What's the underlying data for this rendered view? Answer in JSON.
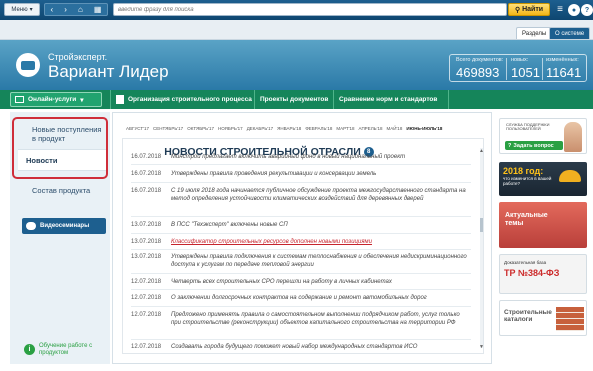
{
  "topbar": {
    "menu_label": "Меню",
    "search_placeholder": "введите фразу для поиска",
    "find_label": "Найти"
  },
  "tabs": {
    "sections": "Разделы",
    "about": "О системе"
  },
  "header": {
    "brand_line1": "Стройэксперт.",
    "brand_line2": "Вариант Лидер",
    "stats": [
      {
        "label": "Всего документов:",
        "value": "469893"
      },
      {
        "label": "новых:",
        "value": "1051"
      },
      {
        "label": "изменённых:",
        "value": "11641"
      }
    ]
  },
  "nav": {
    "online": "Онлайн-услуги",
    "items": [
      "Организация строительного процесса",
      "Проекты документов",
      "Сравнение норм и стандартов"
    ]
  },
  "sidebar": {
    "new_arrivals": "Новые поступления в продукт",
    "news": "Новости",
    "composition": "Состав продукта",
    "webinars": "Видеосеминары",
    "learn": "Обучение работе с продуктом"
  },
  "months": [
    "АВГУСТ'17",
    "СЕНТЯБРЬ'17",
    "ОКТЯБРЬ'17",
    "НОЯБРЬ'17",
    "ДЕКАБРЬ'17",
    "ЯНВАРЬ'18",
    "ФЕВРАЛЬ'18",
    "МАРТ'18",
    "АПРЕЛЬ'18",
    "МАЙ'18",
    "ИЮНЬ-ИЮЛЬ'18"
  ],
  "feed": {
    "title": "НОВОСТИ СТРОИТЕЛЬНОЙ ОТРАСЛИ",
    "badge": "8",
    "rows": [
      {
        "date": "16.07.2018",
        "text": "Минстрой предлагает включить аварийный фонд в новый национальный проект"
      },
      {
        "date": "16.07.2018",
        "text": "Утверждены правила проведения рекультивации и консервации земель"
      },
      {
        "date": "16.07.2018",
        "text": "С 19 июля 2018 года начинается публичное обсуждение проекта межгосударственного стандарта на метод определения устойчивости климатических воздействий для деревянных дверей"
      },
      {
        "date": "13.07.2018",
        "text": "В ПСС \"Техэксперт\" включены новые СП"
      },
      {
        "date": "13.07.2018",
        "text": "Классификатор строительных ресурсов дополнен новыми позициями"
      },
      {
        "date": "13.07.2018",
        "text": "Утверждены правила подключения к системам теплоснабжения и обеспечения недискриминационного доступа к услугам по передаче тепловой энергии"
      },
      {
        "date": "12.07.2018",
        "text": "Четверть всех строительных СРО перешли на работу в личных кабинетах"
      },
      {
        "date": "12.07.2018",
        "text": "О заключении долгосрочных контрактов на содержание и ремонт автомобильных дорог"
      },
      {
        "date": "12.07.2018",
        "text": "Предложено применять правила о самостоятельном выполнении подрядчиком работ, услуг только при строительстве (реконструкции) объектов капитального строительства на территории РФ"
      },
      {
        "date": "12.07.2018",
        "text": "Создавать города будущего поможет новый набор международных стандартов ИСО"
      }
    ]
  },
  "banners": {
    "support_small": "СЛУЖБА ПОДДЕРЖКИ ПОЛЬЗОВАТЕЛЕЙ",
    "ask": "Задать вопрос",
    "year": "2018 год:",
    "year_sub": "что изменится в вашей работе?",
    "actual": "Актуальные темы",
    "doc_base": "Доказательная база",
    "tr": "ТР №384-ФЗ",
    "catalogs": "Строительные каталоги"
  }
}
